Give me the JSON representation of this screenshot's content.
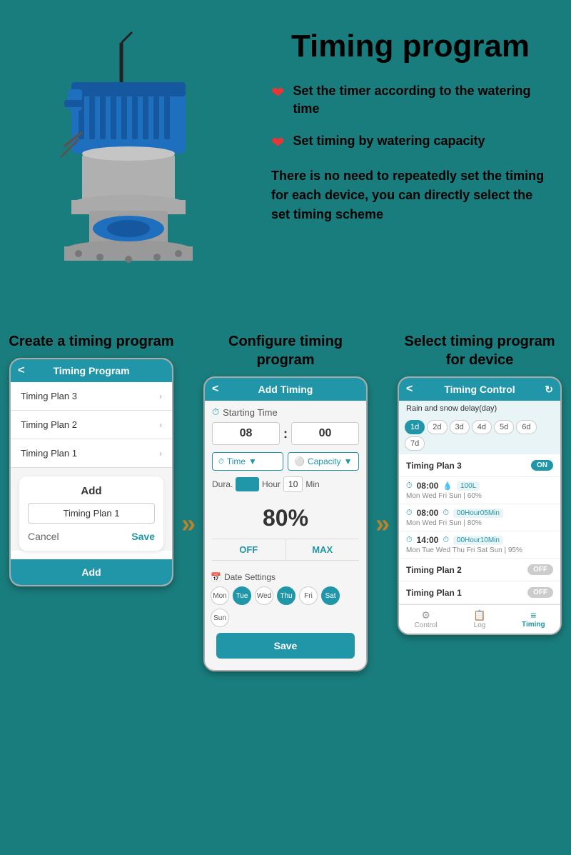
{
  "page": {
    "title": "Timing program",
    "bg_color": "#1a7d7d"
  },
  "top_right": {
    "bullet1": "Set the timer according to the watering time",
    "bullet2": "Set timing by watering capacity",
    "description": "There is no need to repeatedly set the timing for each device, you can directly select the set timing scheme"
  },
  "phone1": {
    "header": "Timing Program",
    "col_title": "Create a timing program",
    "plans": [
      "Timing Plan 3",
      "Timing Plan 2",
      "Timing Plan 1"
    ],
    "add_dialog": {
      "title": "Add",
      "input_value": "Timing Plan 1",
      "cancel": "Cancel",
      "save": "Save"
    },
    "footer": "Add"
  },
  "phone2": {
    "header": "Add Timing",
    "col_title": "Configure timing program",
    "starting_time_label": "Starting Time",
    "hour": "08",
    "minute": "00",
    "row1_left": "Time",
    "row1_right": "Capacity",
    "dura_label": "Dura.",
    "dura_hour": "Hour",
    "dura_value": "10",
    "dura_min": "Min",
    "percent": "80%",
    "off_label": "OFF",
    "max_label": "MAX",
    "date_label": "Date Settings",
    "days": [
      {
        "label": "Mon",
        "active": false
      },
      {
        "label": "Tue",
        "active": true
      },
      {
        "label": "Wed",
        "active": false
      },
      {
        "label": "Thu",
        "active": true
      },
      {
        "label": "Fri",
        "active": false
      },
      {
        "label": "Sat",
        "active": true
      },
      {
        "label": "Sun",
        "active": false
      }
    ],
    "save_btn": "Save"
  },
  "phone3": {
    "header": "Timing Control",
    "col_title": "Select timing program for device",
    "rain_delay": "Rain and snow delay(day)",
    "day_tabs": [
      "1d",
      "2d",
      "3d",
      "4d",
      "5d",
      "6d",
      "7d"
    ],
    "active_tab_index": 0,
    "plan3_label": "Timing Plan 3",
    "plan3_toggle": "ON",
    "schedules": [
      {
        "time": "08:00",
        "capacity": "100L",
        "days": "Mon Wed Fri Sun",
        "percent": "60%"
      },
      {
        "time": "08:00",
        "capacity": "00Hour05Min",
        "days": "Mon Wed Fri Sun",
        "percent": "80%"
      },
      {
        "time": "14:00",
        "capacity": "00Hour10Min",
        "days": "Mon Tue Wed Thu Fri Sat Sun",
        "percent": "95%"
      }
    ],
    "plan2_label": "Timing Plan 2",
    "plan2_toggle": "OFF",
    "plan1_label": "Timing Plan 1",
    "plan1_toggle": "OFF",
    "nav": [
      {
        "label": "Control",
        "icon": "⚙"
      },
      {
        "label": "Log",
        "icon": "📋"
      },
      {
        "label": "Timing",
        "icon": "≡"
      }
    ],
    "active_nav": 2
  }
}
